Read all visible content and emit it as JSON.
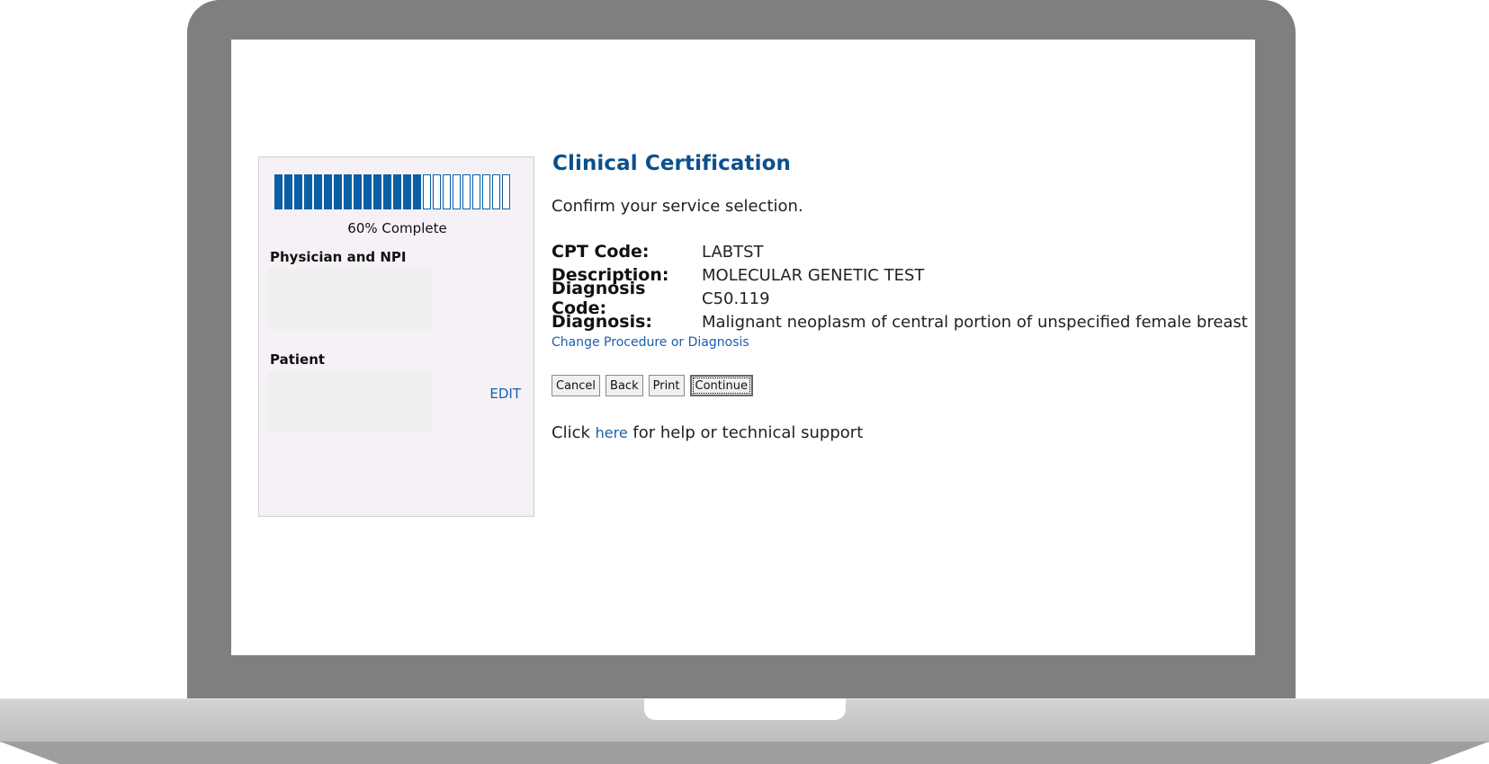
{
  "progress": {
    "percent": 60,
    "segments_total": 24,
    "segments_filled": 15,
    "label": "60% Complete"
  },
  "sidebar": {
    "physician_label": "Physician and NPI",
    "patient_label": "Patient",
    "edit_label": "EDIT"
  },
  "main": {
    "title": "Clinical Certification",
    "subtitle": "Confirm your service selection.",
    "details": [
      {
        "label": "CPT Code:",
        "value": "LABTST"
      },
      {
        "label": "Description:",
        "value": "MOLECULAR GENETIC TEST"
      },
      {
        "label": "Diagnosis Code:",
        "value": "C50.119"
      },
      {
        "label": "Diagnosis:",
        "value": "Malignant neoplasm of central portion of unspecified female breast"
      }
    ],
    "change_link": "Change Procedure or Diagnosis",
    "buttons": {
      "cancel": "Cancel",
      "back": "Back",
      "print": "Print",
      "continue": "Continue"
    },
    "help": {
      "prefix": "Click ",
      "link": "here",
      "suffix": " for help or technical support"
    }
  },
  "colors": {
    "accent": "#0b4f8e",
    "progress_fill": "#0b5fa5",
    "link": "#1a5fa8",
    "frame": "#7f7f7f"
  }
}
